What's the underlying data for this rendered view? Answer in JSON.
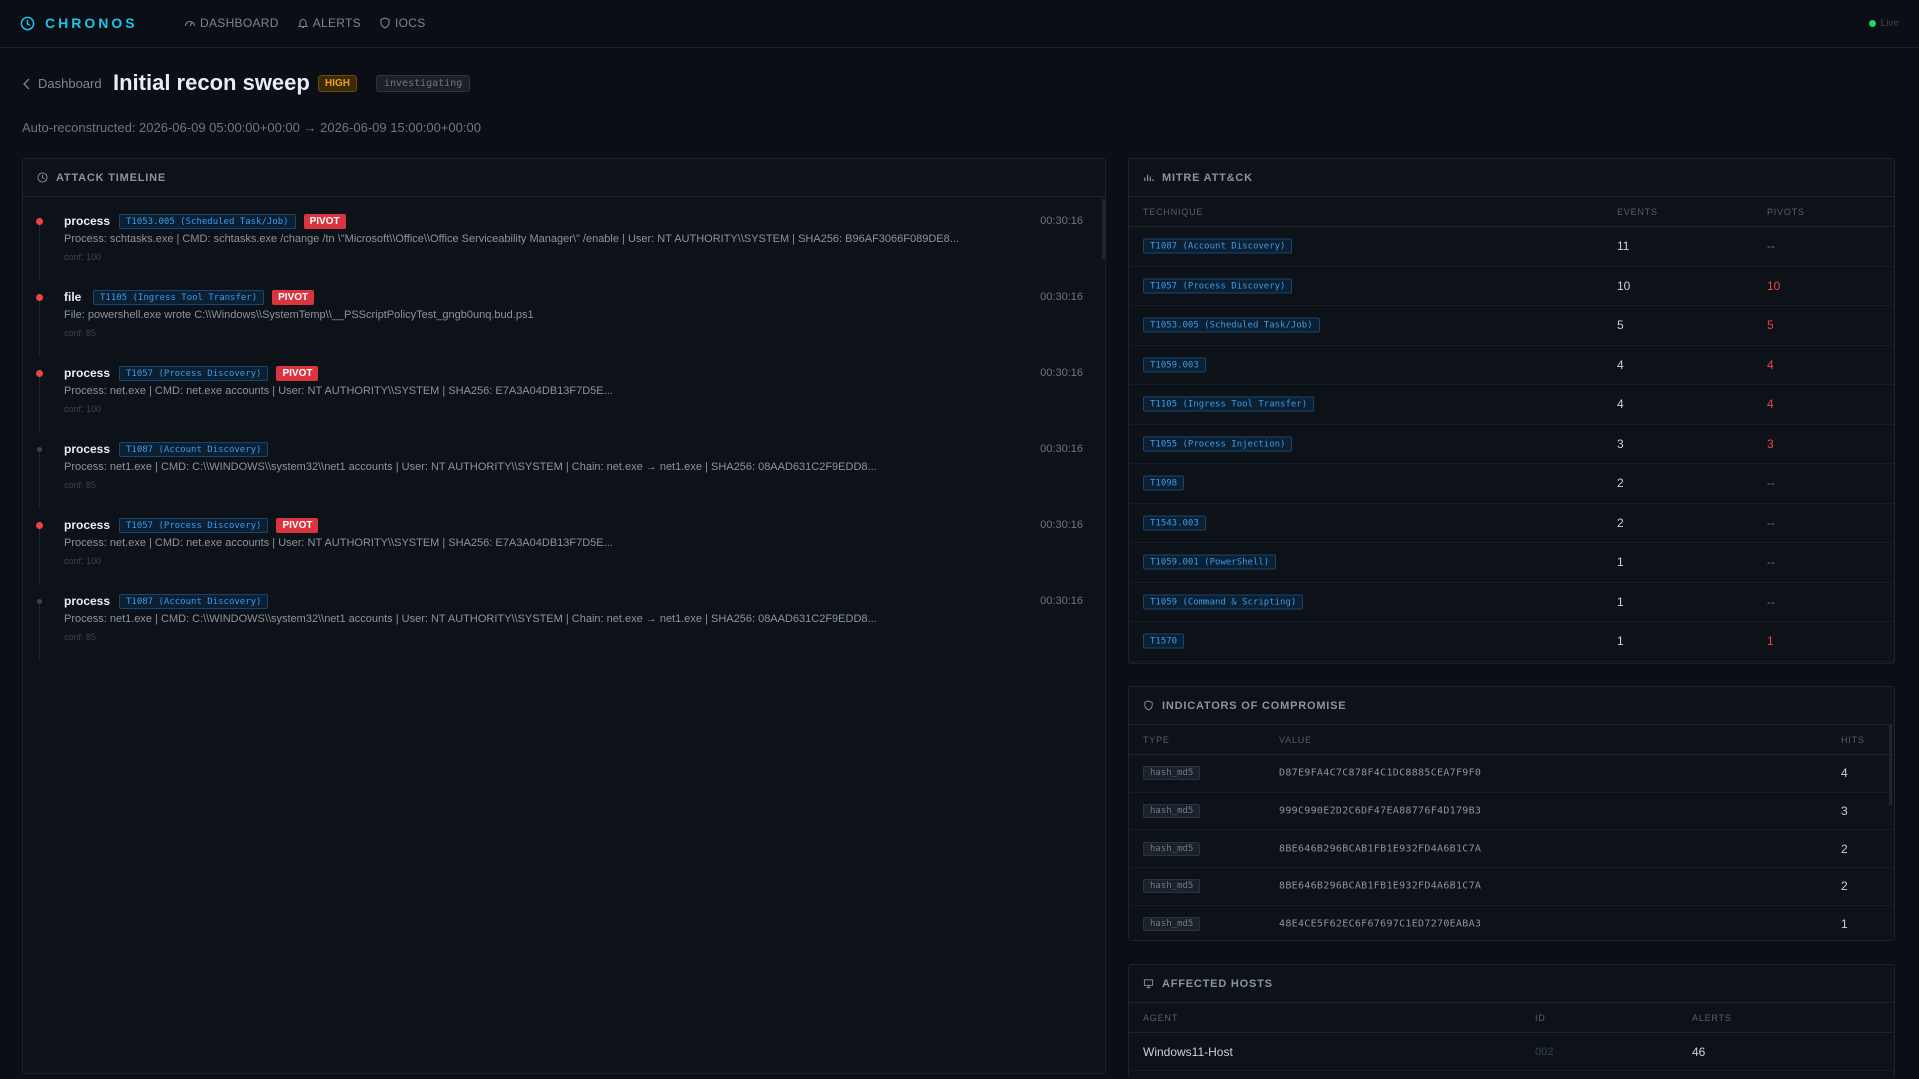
{
  "nav": {
    "brand": "CHRONOS",
    "links": [
      {
        "label": "DASHBOARD",
        "icon": "dashboard-icon"
      },
      {
        "label": "ALERTS",
        "icon": "bell-icon"
      },
      {
        "label": "IOCS",
        "icon": "shield-icon"
      }
    ],
    "live_label": "Live"
  },
  "header": {
    "back_label": "Dashboard",
    "title": "Initial recon sweep",
    "severity": "HIGH",
    "status": "investigating",
    "subtitle": "Auto-reconstructed: 2026-06-09 05:00:00+00:00 → 2026-06-09 15:00:00+00:00"
  },
  "timeline": {
    "heading": "ATTACK TIMELINE",
    "events": [
      {
        "type": "process",
        "technique": "T1053.005 (Scheduled Task/Job)",
        "pivot": "PIVOT",
        "time": "00:30:16",
        "desc": "Process: schtasks.exe | CMD: schtasks.exe /change /tn \\\"Microsoft\\\\Office\\\\Office Serviceability Manager\\\" /enable | User: NT AUTHORITY\\\\SYSTEM | SHA256: B96AF3066F089DE8...",
        "conf": "conf: 100",
        "dot": "red"
      },
      {
        "type": "file",
        "technique": "T1105 (Ingress Tool Transfer)",
        "pivot": "PIVOT",
        "time": "00:30:16",
        "desc": "File: powershell.exe wrote C:\\\\Windows\\\\SystemTemp\\\\__PSScriptPolicyTest_gngb0unq.bud.ps1",
        "conf": "conf: 85",
        "dot": "red"
      },
      {
        "type": "process",
        "technique": "T1057 (Process Discovery)",
        "pivot": "PIVOT",
        "time": "00:30:16",
        "desc": "Process: net.exe | CMD: net.exe accounts | User: NT AUTHORITY\\\\SYSTEM | SHA256: E7A3A04DB13F7D5E...",
        "conf": "conf: 100",
        "dot": "red"
      },
      {
        "type": "process",
        "technique": "T1087 (Account Discovery)",
        "pivot": "",
        "time": "00:30:16",
        "desc": "Process: net1.exe | CMD: C:\\\\WINDOWS\\\\system32\\\\net1 accounts | User: NT AUTHORITY\\\\SYSTEM | Chain: net.exe → net1.exe | SHA256: 08AAD631C2F9EDD8...",
        "conf": "conf: 85",
        "dot": "gray"
      },
      {
        "type": "process",
        "technique": "T1057 (Process Discovery)",
        "pivot": "PIVOT",
        "time": "00:30:16",
        "desc": "Process: net.exe | CMD: net.exe accounts | User: NT AUTHORITY\\\\SYSTEM | SHA256: E7A3A04DB13F7D5E...",
        "conf": "conf: 100",
        "dot": "red"
      },
      {
        "type": "process",
        "technique": "T1087 (Account Discovery)",
        "pivot": "",
        "time": "00:30:16",
        "desc": "Process: net1.exe | CMD: C:\\\\WINDOWS\\\\system32\\\\net1 accounts | User: NT AUTHORITY\\\\SYSTEM | Chain: net.exe → net1.exe | SHA256: 08AAD631C2F9EDD8...",
        "conf": "conf: 85",
        "dot": "gray"
      }
    ]
  },
  "mitre": {
    "heading": "MITRE ATT&CK",
    "columns": [
      "TECHNIQUE",
      "EVENTS",
      "PIVOTS"
    ],
    "rows": [
      {
        "technique": "T1087 (Account Discovery)",
        "events": "11",
        "pivots": "--"
      },
      {
        "technique": "T1057 (Process Discovery)",
        "events": "10",
        "pivots": "10"
      },
      {
        "technique": "T1053.005 (Scheduled Task/Job)",
        "events": "5",
        "pivots": "5"
      },
      {
        "technique": "T1059.003",
        "events": "4",
        "pivots": "4"
      },
      {
        "technique": "T1105 (Ingress Tool Transfer)",
        "events": "4",
        "pivots": "4"
      },
      {
        "technique": "T1055 (Process Injection)",
        "events": "3",
        "pivots": "3"
      },
      {
        "technique": "T1098",
        "events": "2",
        "pivots": "--"
      },
      {
        "technique": "T1543.003",
        "events": "2",
        "pivots": "--"
      },
      {
        "technique": "T1059.001 (PowerShell)",
        "events": "1",
        "pivots": "--"
      },
      {
        "technique": "T1059 (Command & Scripting)",
        "events": "1",
        "pivots": "--"
      },
      {
        "technique": "T1570",
        "events": "1",
        "pivots": "1"
      }
    ]
  },
  "iocs": {
    "heading": "INDICATORS OF COMPROMISE",
    "columns": [
      "TYPE",
      "VALUE",
      "HITS"
    ],
    "rows": [
      {
        "type": "hash_md5",
        "value": "D87E9FA4C7C878F4C1DC8885CEA7F9F0",
        "hits": "4"
      },
      {
        "type": "hash_md5",
        "value": "999C990E2D2C6DF47EA88776F4D179B3",
        "hits": "3"
      },
      {
        "type": "hash_md5",
        "value": "8BE646B296BCAB1FB1E932FD4A6B1C7A",
        "hits": "2"
      },
      {
        "type": "hash_md5",
        "value": "8BE646B296BCAB1FB1E932FD4A6B1C7A",
        "hits": "2"
      },
      {
        "type": "hash_md5",
        "value": "48E4CE5F62EC6F67697C1ED7270EABA3",
        "hits": "1"
      }
    ]
  },
  "hosts": {
    "heading": "AFFECTED HOSTS",
    "columns": [
      "AGENT",
      "ID",
      "ALERTS"
    ],
    "rows": [
      {
        "agent": "Windows11-Host",
        "id": "002",
        "alerts": "46"
      }
    ]
  },
  "colors": {
    "brand": "#22c2e6",
    "pivot": "#d9343f",
    "severity_high": "#f0a020",
    "technique_tag": "#3b9ae8",
    "live": "#22d36a"
  }
}
